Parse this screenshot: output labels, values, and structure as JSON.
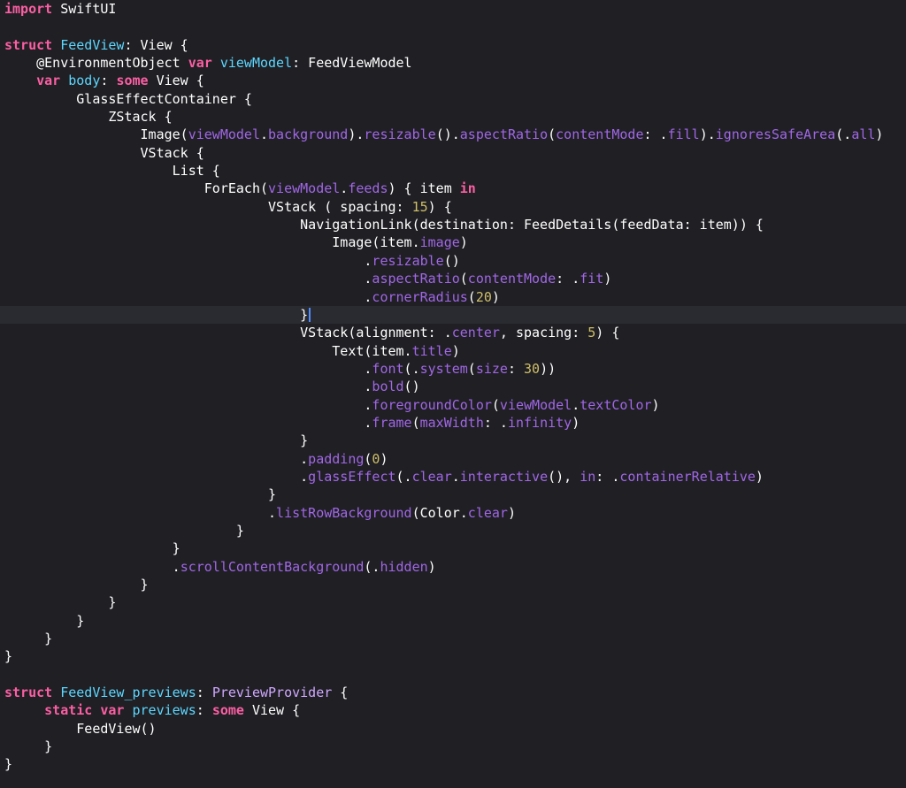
{
  "editor": {
    "language": "Swift",
    "cursor_line": 17,
    "colors": {
      "background": "#1f1f24",
      "current_line": "#2a2b30",
      "keyword": "#fc5fa3",
      "type": "#d0a8ff",
      "type_declaration": "#5dd8ff",
      "member": "#a167e6",
      "number": "#d0bf69",
      "plain": "#ffffff",
      "cursor": "#4f8cff"
    },
    "lines": [
      [
        {
          "t": "import",
          "c": "kw"
        },
        {
          "t": " SwiftUI",
          "c": "pl"
        }
      ],
      [],
      [
        {
          "t": "struct",
          "c": "kw"
        },
        {
          "t": " ",
          "c": "pl"
        },
        {
          "t": "FeedView",
          "c": "tyd"
        },
        {
          "t": ": View {",
          "c": "pl"
        }
      ],
      [
        {
          "t": "    @EnvironmentObject ",
          "c": "pl"
        },
        {
          "t": "var",
          "c": "kw"
        },
        {
          "t": " ",
          "c": "pl"
        },
        {
          "t": "viewModel",
          "c": "tyd"
        },
        {
          "t": ": FeedViewModel",
          "c": "pl"
        }
      ],
      [
        {
          "t": "    ",
          "c": "pl"
        },
        {
          "t": "var",
          "c": "kw"
        },
        {
          "t": " ",
          "c": "pl"
        },
        {
          "t": "body",
          "c": "tyd"
        },
        {
          "t": ": ",
          "c": "pl"
        },
        {
          "t": "some",
          "c": "kw"
        },
        {
          "t": " View {",
          "c": "pl"
        }
      ],
      [
        {
          "t": "         GlassEffectContainer {",
          "c": "pl"
        }
      ],
      [
        {
          "t": "             ZStack {",
          "c": "pl"
        }
      ],
      [
        {
          "t": "                 Image(",
          "c": "pl"
        },
        {
          "t": "viewModel",
          "c": "fn"
        },
        {
          "t": ".",
          "c": "pl"
        },
        {
          "t": "background",
          "c": "fn"
        },
        {
          "t": ").",
          "c": "pl"
        },
        {
          "t": "resizable",
          "c": "fn"
        },
        {
          "t": "().",
          "c": "pl"
        },
        {
          "t": "aspectRatio",
          "c": "fn"
        },
        {
          "t": "(",
          "c": "pl"
        },
        {
          "t": "contentMode",
          "c": "fn"
        },
        {
          "t": ": .",
          "c": "pl"
        },
        {
          "t": "fill",
          "c": "fn"
        },
        {
          "t": ").",
          "c": "pl"
        },
        {
          "t": "ignoresSafeArea",
          "c": "fn"
        },
        {
          "t": "(.",
          "c": "pl"
        },
        {
          "t": "all",
          "c": "fn"
        },
        {
          "t": ")",
          "c": "pl"
        }
      ],
      [
        {
          "t": "                 VStack {",
          "c": "pl"
        }
      ],
      [
        {
          "t": "                     List {",
          "c": "pl"
        }
      ],
      [
        {
          "t": "                         ForEach(",
          "c": "pl"
        },
        {
          "t": "viewModel",
          "c": "fn"
        },
        {
          "t": ".",
          "c": "pl"
        },
        {
          "t": "feeds",
          "c": "fn"
        },
        {
          "t": ") { item ",
          "c": "pl"
        },
        {
          "t": "in",
          "c": "kw"
        }
      ],
      [
        {
          "t": "                                 VStack ( spacing: ",
          "c": "pl"
        },
        {
          "t": "15",
          "c": "num"
        },
        {
          "t": ") {",
          "c": "pl"
        }
      ],
      [
        {
          "t": "                                     NavigationLink(destination: FeedDetails(feedData: item)) {",
          "c": "pl"
        }
      ],
      [
        {
          "t": "                                         Image(item.",
          "c": "pl"
        },
        {
          "t": "image",
          "c": "fn"
        },
        {
          "t": ")",
          "c": "pl"
        }
      ],
      [
        {
          "t": "                                             .",
          "c": "pl"
        },
        {
          "t": "resizable",
          "c": "fn"
        },
        {
          "t": "()",
          "c": "pl"
        }
      ],
      [
        {
          "t": "                                             .",
          "c": "pl"
        },
        {
          "t": "aspectRatio",
          "c": "fn"
        },
        {
          "t": "(",
          "c": "pl"
        },
        {
          "t": "contentMode",
          "c": "fn"
        },
        {
          "t": ": .",
          "c": "pl"
        },
        {
          "t": "fit",
          "c": "fn"
        },
        {
          "t": ")",
          "c": "pl"
        }
      ],
      [
        {
          "t": "                                             .",
          "c": "pl"
        },
        {
          "t": "cornerRadius",
          "c": "fn"
        },
        {
          "t": "(",
          "c": "pl"
        },
        {
          "t": "20",
          "c": "num"
        },
        {
          "t": ")",
          "c": "pl"
        }
      ],
      [
        {
          "t": "                                     }",
          "c": "pl"
        }
      ],
      [
        {
          "t": "                                     VStack(alignment: .",
          "c": "pl"
        },
        {
          "t": "center",
          "c": "fn"
        },
        {
          "t": ", spacing: ",
          "c": "pl"
        },
        {
          "t": "5",
          "c": "num"
        },
        {
          "t": ") {",
          "c": "pl"
        }
      ],
      [
        {
          "t": "                                         Text(item.",
          "c": "pl"
        },
        {
          "t": "title",
          "c": "fn"
        },
        {
          "t": ")",
          "c": "pl"
        }
      ],
      [
        {
          "t": "                                             .",
          "c": "pl"
        },
        {
          "t": "font",
          "c": "fn"
        },
        {
          "t": "(.",
          "c": "pl"
        },
        {
          "t": "system",
          "c": "fn"
        },
        {
          "t": "(",
          "c": "pl"
        },
        {
          "t": "size",
          "c": "fn"
        },
        {
          "t": ": ",
          "c": "pl"
        },
        {
          "t": "30",
          "c": "num"
        },
        {
          "t": "))",
          "c": "pl"
        }
      ],
      [
        {
          "t": "                                             .",
          "c": "pl"
        },
        {
          "t": "bold",
          "c": "fn"
        },
        {
          "t": "()",
          "c": "pl"
        }
      ],
      [
        {
          "t": "                                             .",
          "c": "pl"
        },
        {
          "t": "foregroundColor",
          "c": "fn"
        },
        {
          "t": "(",
          "c": "pl"
        },
        {
          "t": "viewModel",
          "c": "fn"
        },
        {
          "t": ".",
          "c": "pl"
        },
        {
          "t": "textColor",
          "c": "fn"
        },
        {
          "t": ")",
          "c": "pl"
        }
      ],
      [
        {
          "t": "                                             .",
          "c": "pl"
        },
        {
          "t": "frame",
          "c": "fn"
        },
        {
          "t": "(",
          "c": "pl"
        },
        {
          "t": "maxWidth",
          "c": "fn"
        },
        {
          "t": ": .",
          "c": "pl"
        },
        {
          "t": "infinity",
          "c": "fn"
        },
        {
          "t": ")",
          "c": "pl"
        }
      ],
      [
        {
          "t": "                                     }",
          "c": "pl"
        }
      ],
      [
        {
          "t": "                                     .",
          "c": "pl"
        },
        {
          "t": "padding",
          "c": "fn"
        },
        {
          "t": "(",
          "c": "pl"
        },
        {
          "t": "0",
          "c": "num"
        },
        {
          "t": ")",
          "c": "pl"
        }
      ],
      [
        {
          "t": "                                     .",
          "c": "pl"
        },
        {
          "t": "glassEffect",
          "c": "fn"
        },
        {
          "t": "(.",
          "c": "pl"
        },
        {
          "t": "clear",
          "c": "fn"
        },
        {
          "t": ".",
          "c": "pl"
        },
        {
          "t": "interactive",
          "c": "fn"
        },
        {
          "t": "(), ",
          "c": "pl"
        },
        {
          "t": "in",
          "c": "fn"
        },
        {
          "t": ": .",
          "c": "pl"
        },
        {
          "t": "containerRelative",
          "c": "fn"
        },
        {
          "t": ")",
          "c": "pl"
        }
      ],
      [
        {
          "t": "                                 }",
          "c": "pl"
        }
      ],
      [
        {
          "t": "                                 .",
          "c": "pl"
        },
        {
          "t": "listRowBackground",
          "c": "fn"
        },
        {
          "t": "(Color.",
          "c": "pl"
        },
        {
          "t": "clear",
          "c": "fn"
        },
        {
          "t": ")",
          "c": "pl"
        }
      ],
      [
        {
          "t": "                             }",
          "c": "pl"
        }
      ],
      [
        {
          "t": "                     }",
          "c": "pl"
        }
      ],
      [
        {
          "t": "                     .",
          "c": "pl"
        },
        {
          "t": "scrollContentBackground",
          "c": "fn"
        },
        {
          "t": "(.",
          "c": "pl"
        },
        {
          "t": "hidden",
          "c": "fn"
        },
        {
          "t": ")",
          "c": "pl"
        }
      ],
      [
        {
          "t": "                 }",
          "c": "pl"
        }
      ],
      [
        {
          "t": "             }",
          "c": "pl"
        }
      ],
      [
        {
          "t": "         }",
          "c": "pl"
        }
      ],
      [
        {
          "t": "     }",
          "c": "pl"
        }
      ],
      [
        {
          "t": "}",
          "c": "pl"
        }
      ],
      [],
      [
        {
          "t": "struct",
          "c": "kw"
        },
        {
          "t": " ",
          "c": "pl"
        },
        {
          "t": "FeedView_previews",
          "c": "tyd"
        },
        {
          "t": ": ",
          "c": "pl"
        },
        {
          "t": "PreviewProvider",
          "c": "ty"
        },
        {
          "t": " {",
          "c": "pl"
        }
      ],
      [
        {
          "t": "     ",
          "c": "pl"
        },
        {
          "t": "static",
          "c": "kw"
        },
        {
          "t": " ",
          "c": "pl"
        },
        {
          "t": "var",
          "c": "kw"
        },
        {
          "t": " ",
          "c": "pl"
        },
        {
          "t": "previews",
          "c": "tyd"
        },
        {
          "t": ": ",
          "c": "pl"
        },
        {
          "t": "some",
          "c": "kw"
        },
        {
          "t": " View {",
          "c": "pl"
        }
      ],
      [
        {
          "t": "         FeedView()",
          "c": "pl"
        }
      ],
      [
        {
          "t": "     }",
          "c": "pl"
        }
      ],
      [
        {
          "t": "}",
          "c": "pl"
        }
      ]
    ]
  }
}
